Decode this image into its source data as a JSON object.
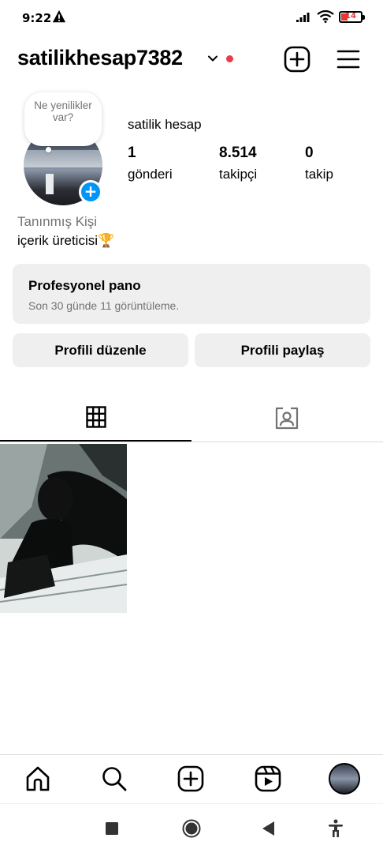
{
  "status_bar": {
    "time": "9:22",
    "battery": "14",
    "icons": [
      "warning-icon",
      "signal-icon",
      "wifi-icon",
      "battery-icon"
    ]
  },
  "header": {
    "username": "satilikhesap7382",
    "icons": [
      "chevron-down-icon",
      "new-post-icon",
      "menu-icon"
    ],
    "accent_dot_color": "#ed3949"
  },
  "profile": {
    "note": "Ne yenilikler var?",
    "display_name": "satilik hesap",
    "stats": [
      {
        "value": "1",
        "label": "gönderi"
      },
      {
        "value": "8.514",
        "label": "takipçi"
      },
      {
        "value": "0",
        "label": "takip"
      }
    ],
    "category": "Tanınmış Kişi",
    "bio": "içerik üreticisi🏆"
  },
  "dashboard": {
    "title": "Profesyonel pano",
    "subtitle": "Son 30 günde 11 görüntüleme."
  },
  "actions": {
    "edit_profile": "Profili düzenle",
    "share_profile": "Profili paylaş"
  },
  "tabs": [
    "grid-icon",
    "tagged-icon"
  ],
  "bottom_nav": [
    "home-icon",
    "search-icon",
    "create-icon",
    "reels-icon",
    "profile-avatar"
  ],
  "system_nav": [
    "recents-icon",
    "home-circle-icon",
    "back-icon",
    "accessibility-icon"
  ],
  "colors": {
    "brand_blue": "#0095f6",
    "button_bg": "#efefef",
    "muted_text": "#737373"
  }
}
